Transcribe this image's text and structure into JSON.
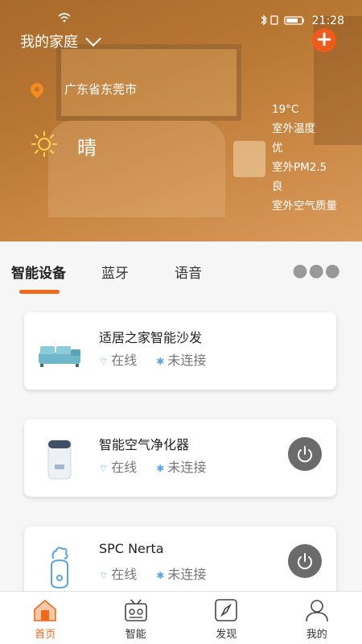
{
  "status_bar": {
    "time": "21:28",
    "icons": "✱ ▯◂"
  },
  "header": {
    "home_title": "我的家庭",
    "location": "广东省东莞市",
    "weather": "晴",
    "stats": [
      {
        "value": "19°C",
        "label": "室外温度"
      },
      {
        "value": "优",
        "label": "室外PM2.5"
      },
      {
        "value": "良",
        "label": "室外空气质量"
      }
    ]
  },
  "tabs": [
    "智能设备",
    "蓝牙",
    "语音"
  ],
  "devices": [
    {
      "name": "适居之家智能沙发",
      "online": "在线",
      "bluetooth": "未连接",
      "has_power": false
    },
    {
      "name": "智能空气净化器",
      "online": "在线",
      "bluetooth": "未连接",
      "has_power": true
    },
    {
      "name": "SPC Nerta",
      "online": "在线",
      "bluetooth": "未连接",
      "has_power": true
    }
  ],
  "bottom_nav": [
    {
      "label": "首页",
      "icon": "home-icon",
      "active": true
    },
    {
      "label": "智能",
      "icon": "radio-icon",
      "active": false
    },
    {
      "label": "发现",
      "icon": "compass-icon",
      "active": false
    },
    {
      "label": "我的",
      "icon": "user-icon",
      "active": false
    }
  ],
  "colors": {
    "accent": "#ef6a1b",
    "add_button": "#f05a1a",
    "power_button": "#6b6b6b",
    "link_blue": "#5ba4e6"
  }
}
